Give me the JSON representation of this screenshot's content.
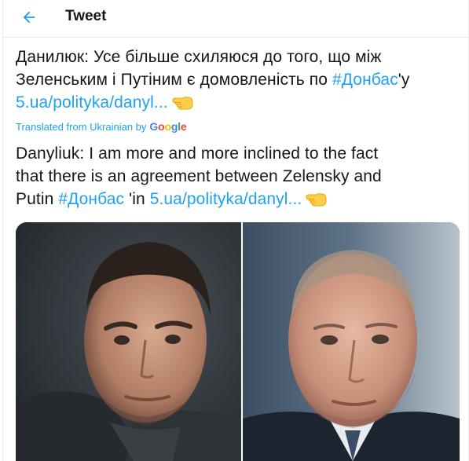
{
  "header": {
    "title": "Tweet",
    "back_icon": "arrow-left-icon",
    "accent": "#1da1f2"
  },
  "tweet": {
    "original": {
      "line1": "Данилюк: Усе більше схиляюся до того, що між",
      "line2_text": "Зеленським і Путіним є домовленість по ",
      "line2_hashtag": "#Донбас",
      "line2_tail": "'у",
      "link": "5.ua/polityka/danyl...",
      "emoji": "backhand-index-pointing-left-icon"
    },
    "translation_note": {
      "prefix": "Translated from Ukrainian by",
      "brand": [
        "G",
        "o",
        "o",
        "g",
        "l",
        "e"
      ]
    },
    "translated": {
      "line1": "Danyliuk: I am more and more inclined to the fact",
      "line2": "that there is an agreement between Zelensky and",
      "line3_text": "Putin ",
      "line3_hashtag": "#Донбас",
      "line3_mid": " 'in ",
      "link": "5.ua/polityka/danyl...",
      "emoji": "backhand-index-pointing-left-icon"
    },
    "media": {
      "left_photo": "zelensky-photo",
      "right_photo": "putin-photo"
    }
  }
}
